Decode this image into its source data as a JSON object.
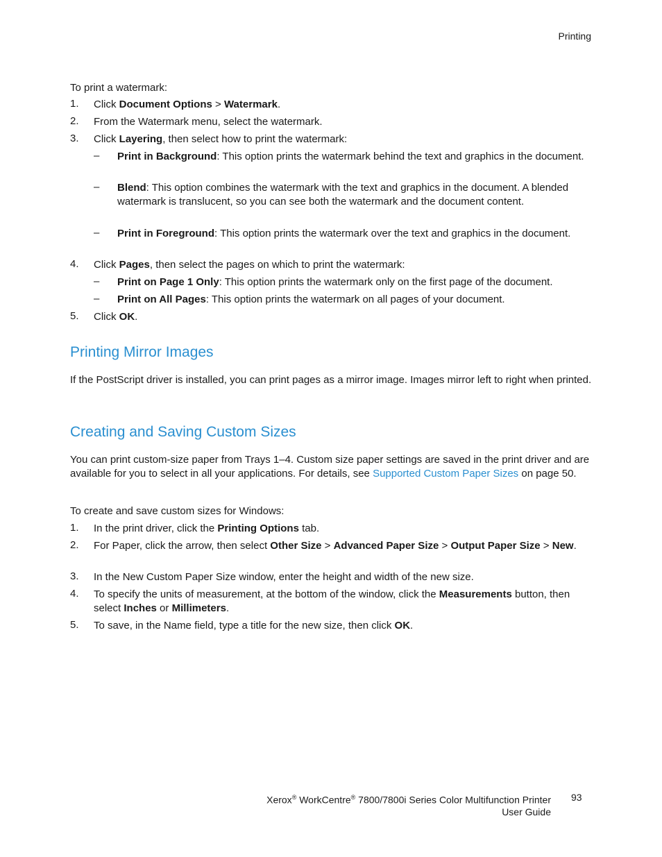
{
  "header": {
    "section": "Printing"
  },
  "watermark": {
    "intro": "To print a watermark:",
    "steps": [
      {
        "n": "1.",
        "pre": "Click ",
        "b1": "Document Options",
        "mid": " > ",
        "b2": "Watermark",
        "post": "."
      },
      {
        "n": "2.",
        "text": "From the Watermark menu, select the watermark."
      },
      {
        "n": "3.",
        "pre": "Click ",
        "b1": "Layering",
        "post": ", then select how to print the watermark:"
      },
      {
        "n": "4.",
        "pre": "Click ",
        "b1": "Pages",
        "post": ", then select the pages on which to print the watermark:"
      },
      {
        "n": "5.",
        "pre": "Click ",
        "b1": "OK",
        "post": "."
      }
    ],
    "layering": [
      {
        "b": "Print in Background",
        "t": ": This option prints the watermark behind the text and graphics in the document."
      },
      {
        "b": "Blend",
        "t": ": This option combines the watermark with the text and graphics in the document. A blended watermark is translucent, so you can see both the watermark and the document content."
      },
      {
        "b": "Print in Foreground",
        "t": ": This option prints the watermark over the text and graphics in the document."
      }
    ],
    "pages": [
      {
        "b": "Print on Page 1 Only",
        "t": ": This option prints the watermark only on the first page of the document."
      },
      {
        "b": "Print on All Pages",
        "t": ": This option prints the watermark on all pages of your document."
      }
    ]
  },
  "mirror": {
    "heading": "Printing Mirror Images",
    "body": "If the PostScript driver is installed, you can print pages as a mirror image. Images mirror left to right when printed."
  },
  "custom": {
    "heading": "Creating and Saving Custom Sizes",
    "body_pre": "You can print custom-size paper from Trays 1–4. Custom size paper settings are saved in the print driver and are available for you to select in all your applications. For details, see ",
    "link": "Supported Custom Paper Sizes",
    "body_post": " on page 50.",
    "intro": "To create and save custom sizes for Windows:",
    "s1_pre": "In the print driver, click the ",
    "s1_b": "Printing Options",
    "s1_post": " tab.",
    "s2_pre": "For Paper, click the arrow, then select ",
    "s2_b1": "Other Size",
    "s2_b2": "Advanced Paper Size",
    "s2_b3": "Output Paper Size",
    "s2_b4": "New",
    "sep": " > ",
    "s3": "In the New Custom Paper Size window, enter the height and width of the new size.",
    "s4_pre": "To specify the units of measurement, at the bottom of the window, click the ",
    "s4_b1": "Measurements",
    "s4_mid": " button, then select ",
    "s4_b2": "Inches",
    "s4_or": " or ",
    "s4_b3": "Millimeters",
    "s4_post": ".",
    "s5_pre": "To save, in the Name field, type a title for the new size, then click ",
    "s5_b": "OK",
    "s5_post": "."
  },
  "footer": {
    "brand": "Xerox",
    "reg": "®",
    "product": " WorkCentre",
    "model": " 7800/7800i Series Color Multifunction Printer",
    "guide": "User Guide",
    "page": "93"
  }
}
